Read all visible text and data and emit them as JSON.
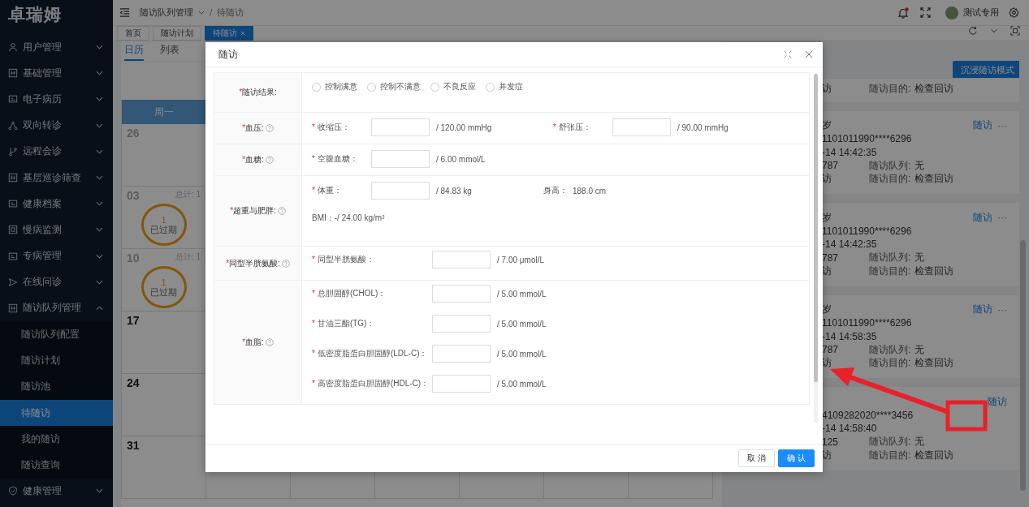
{
  "sidebar": {
    "logo": "卓瑞姆",
    "items": [
      {
        "label": "用户管理",
        "expanded": false
      },
      {
        "label": "基础管理",
        "expanded": false
      },
      {
        "label": "电子病历",
        "expanded": false
      },
      {
        "label": "双向转诊",
        "expanded": false
      },
      {
        "label": "远程会诊",
        "expanded": false
      },
      {
        "label": "基层巡诊筛查",
        "expanded": false
      },
      {
        "label": "健康档案",
        "expanded": false
      },
      {
        "label": "慢病监测",
        "expanded": false
      },
      {
        "label": "专病管理",
        "expanded": false
      },
      {
        "label": "在线问诊",
        "expanded": false
      },
      {
        "label": "随访队列管理",
        "expanded": true,
        "children": [
          {
            "label": "随访队列配置",
            "selected": false
          },
          {
            "label": "随访计划",
            "selected": false
          },
          {
            "label": "随访池",
            "selected": false
          },
          {
            "label": "待随访",
            "selected": true
          },
          {
            "label": "我的随访",
            "selected": false
          },
          {
            "label": "随访查询",
            "selected": false
          }
        ]
      },
      {
        "label": "健康管理",
        "expanded": false
      }
    ]
  },
  "topbar": {
    "breadcrumb": [
      "随访队列管理",
      "待随访"
    ],
    "separator": "/",
    "unread": true,
    "user": "测试专用"
  },
  "tabs": [
    {
      "label": "首页",
      "selected": false,
      "closable": false
    },
    {
      "label": "随访计划",
      "selected": false,
      "closable": false
    },
    {
      "label": "待随访",
      "selected": true,
      "closable": true
    }
  ],
  "view_tabs": [
    {
      "label": "日历",
      "selected": true
    },
    {
      "label": "列表",
      "selected": false
    }
  ],
  "calendar": {
    "weekday": "周一",
    "days": [
      {
        "date": "26",
        "muted": true
      },
      {
        "date": "03",
        "muted": true,
        "total": "总计: 1",
        "badge": {
          "count": "1",
          "status": "已过期"
        }
      },
      {
        "date": "10",
        "muted": true,
        "total": "总计: 1",
        "badge": {
          "count": "1",
          "status": "已过期"
        }
      },
      {
        "date": "17",
        "muted": false
      },
      {
        "date": "24",
        "muted": false
      },
      {
        "date": "31",
        "muted": false
      }
    ]
  },
  "immersive_button": "沉浸随访模式",
  "cards": [
    {
      "method_tail": "访",
      "purpose_label": "随访目的:",
      "purpose": "检查回访"
    },
    {
      "name_tail": "岁",
      "action": "随访",
      "more": "···",
      "id_tail": "1101011990****6296",
      "time_tail": "-14 14:42:35",
      "phone_tail": "787",
      "queue_label": "随访队列:",
      "queue": "无",
      "method_tail": "访",
      "purpose_label": "随访目的:",
      "purpose": "检查回访"
    },
    {
      "name_tail": "岁",
      "action": "随访",
      "more": "···",
      "id_tail": "1101011990****6296",
      "time_tail": "-14 14:42:35",
      "phone_tail": "787",
      "queue_label": "随访队列:",
      "queue": "无",
      "method_tail": "访",
      "purpose_label": "随访目的:",
      "purpose": "检查回访"
    },
    {
      "name_tail": "岁",
      "action": "随访",
      "more": "···",
      "id_tail": "1101011990****6296",
      "time_tail": "-14 14:58:35",
      "phone_tail": "787",
      "queue_label": "随访队列:",
      "queue": "无",
      "method_tail": "访",
      "purpose_label": "随访目的:",
      "purpose": "检查回访"
    },
    {
      "action": "随访",
      "id_tail": "4109282020****3456",
      "time_tail": "-14 14:58:40",
      "phone_tail": "125",
      "queue_label": "随访队列:",
      "queue": "无",
      "method_tail": "访",
      "purpose_label": "随访目的:",
      "purpose": "检查回访"
    }
  ],
  "modal": {
    "title": "随访",
    "sections": [
      {
        "label": "随访结果:",
        "mark": "*",
        "help": false,
        "kind": "radios",
        "options": [
          {
            "label": "控制满意",
            "selected": false
          },
          {
            "label": "控制不满意",
            "selected": false
          },
          {
            "label": "不良反应",
            "selected": false
          },
          {
            "label": "并发症",
            "selected": false
          }
        ]
      },
      {
        "label": "血压:",
        "mark": "*",
        "help": true,
        "kind": "inline",
        "items": [
          {
            "kind": "input",
            "mark": "*",
            "label": "收缩压：",
            "unit": "/ 120.00 mmHg"
          },
          {
            "kind": "input",
            "mark": "*",
            "label": "舒张压：",
            "unit": "/ 90.00 mmHg"
          }
        ]
      },
      {
        "label": "血糖:",
        "mark": "*",
        "help": true,
        "kind": "inline",
        "items": [
          {
            "kind": "input",
            "mark": "*",
            "label": "空腹血糖：",
            "unit": "/ 6.00 mmol/L"
          }
        ]
      },
      {
        "label": "超重与肥胖:",
        "mark": "*",
        "help": true,
        "kind": "inline",
        "items": [
          {
            "kind": "input",
            "mark": "*",
            "label": "体重：",
            "unit": "/ 84.83 kg"
          },
          {
            "kind": "reading",
            "label": "身高：",
            "value": "188.0 cm"
          }
        ],
        "note": "BMI：-/ 24.00 kg/m²"
      },
      {
        "label": "同型半胱氨酸:",
        "mark": "*",
        "help": true,
        "kind": "stack",
        "items": [
          {
            "kind": "input",
            "mark": "*",
            "label": "同型半胱氨酸：",
            "unit": "/ 7.00 μmol/L"
          }
        ]
      },
      {
        "label": "血脂:",
        "mark": "*",
        "help": true,
        "kind": "stack",
        "items": [
          {
            "kind": "input",
            "mark": "*",
            "label": "总胆固醇(CHOL)：",
            "unit": "/ 5.00 mmol/L"
          },
          {
            "kind": "input",
            "mark": "*",
            "label": "甘油三酯(TG)：",
            "unit": "/ 5.00 mmol/L"
          },
          {
            "kind": "input",
            "mark": "*",
            "label": "低密度脂蛋白胆固醇(LDL-C)：",
            "unit": "/ 5.00 mmol/L"
          },
          {
            "kind": "input",
            "mark": "*",
            "label": "高密度脂蛋白胆固醇(HDL-C)：",
            "unit": "/ 5.00 mmol/L"
          }
        ]
      }
    ],
    "buttons": [
      {
        "label": "取 消",
        "primary": false
      },
      {
        "label": "确 认",
        "primary": true
      }
    ]
  }
}
